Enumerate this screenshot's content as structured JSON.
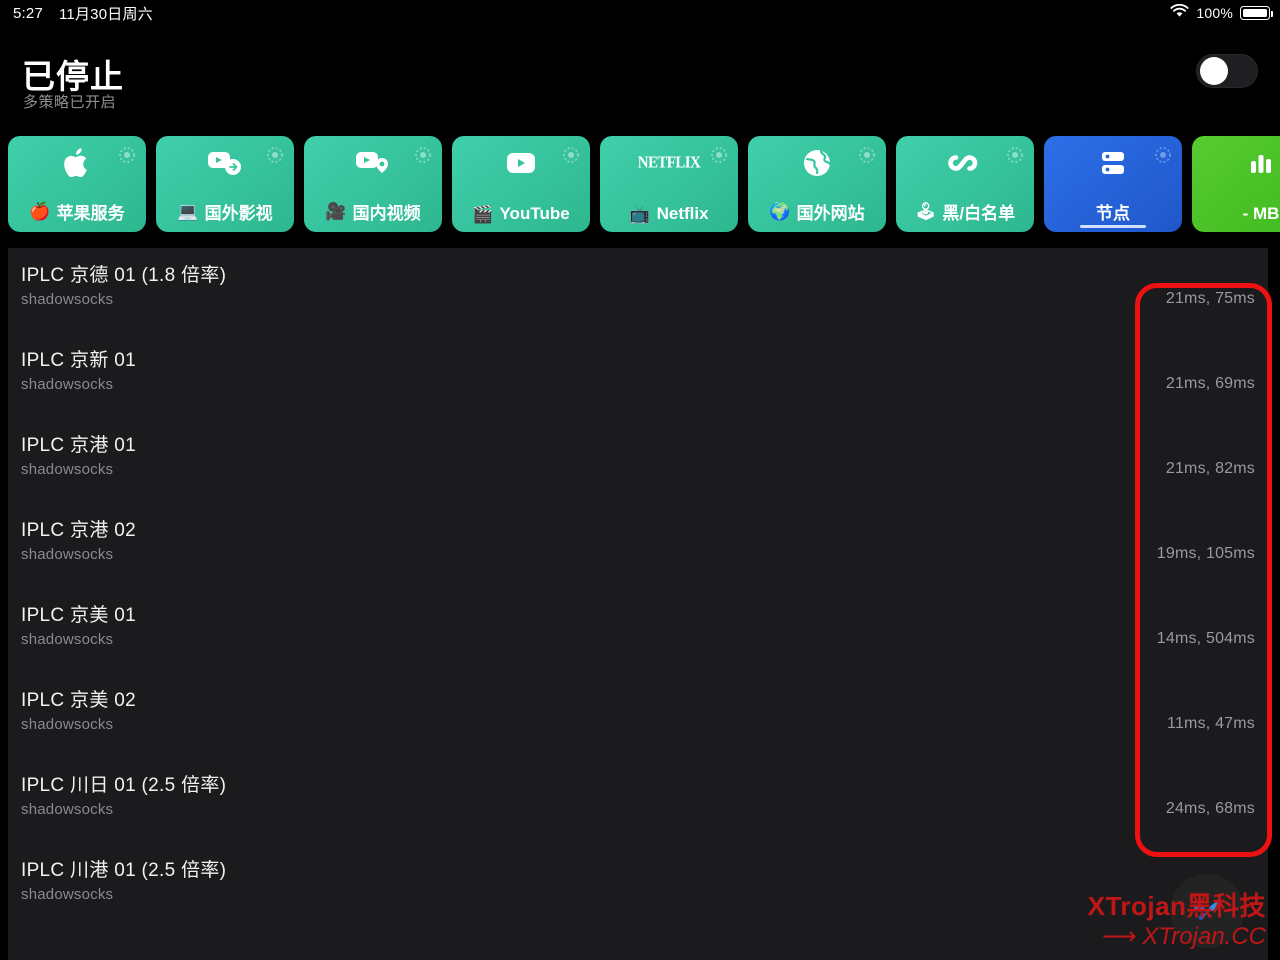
{
  "statusbar": {
    "time": "5:27",
    "date": "11月30日周六",
    "battery_percent": "100%",
    "wifi_icon": "wifi-icon",
    "battery_icon": "battery-full-icon"
  },
  "header": {
    "title": "已停止",
    "subtitle": "多策略已开启",
    "toggle_state": "off"
  },
  "cards": [
    {
      "label": "苹果服务",
      "emoji": "🍎",
      "icon": "apple-logo-icon",
      "gear": "gear-icon",
      "theme": "teal",
      "selected": false
    },
    {
      "label": "国外影视",
      "emoji": "💻",
      "icon": "video-forward-icon",
      "gear": "gear-icon",
      "theme": "teal",
      "selected": false
    },
    {
      "label": "国内视频",
      "emoji": "🎥",
      "icon": "video-pin-icon",
      "gear": "gear-icon",
      "theme": "teal",
      "selected": false
    },
    {
      "label": "YouTube",
      "emoji": "🎬",
      "icon": "youtube-icon",
      "gear": "gear-icon",
      "theme": "teal",
      "selected": false
    },
    {
      "label": "Netflix",
      "emoji": "📺",
      "icon": "netflix-wordmark-icon",
      "icon_text": "NETFLIX",
      "gear": "gear-icon",
      "theme": "teal",
      "selected": false
    },
    {
      "label": "国外网站",
      "emoji": "🌍",
      "icon": "globe-icon",
      "gear": "gear-icon",
      "theme": "teal",
      "selected": false
    },
    {
      "label": "黑/白名单",
      "emoji": "🕹",
      "icon": "infinity-icon",
      "gear": "gear-icon",
      "theme": "teal",
      "selected": false
    },
    {
      "label": "节点",
      "emoji": "",
      "icon": "server-icon",
      "gear": "gear-icon",
      "theme": "blue",
      "selected": true
    },
    {
      "label": "- MB",
      "emoji": "",
      "icon": "bar-chart-icon",
      "gear": "",
      "theme": "green",
      "selected": false
    }
  ],
  "nodes": [
    {
      "name": "IPLC 京德 01 (1.8 倍率)",
      "type": "shadowsocks",
      "latency": "21ms, 75ms"
    },
    {
      "name": "IPLC 京新 01",
      "type": "shadowsocks",
      "latency": "21ms, 69ms"
    },
    {
      "name": "IPLC 京港 01",
      "type": "shadowsocks",
      "latency": "21ms, 82ms"
    },
    {
      "name": "IPLC 京港 02",
      "type": "shadowsocks",
      "latency": "19ms, 105ms"
    },
    {
      "name": "IPLC 京美 01",
      "type": "shadowsocks",
      "latency": "14ms, 504ms"
    },
    {
      "name": "IPLC 京美 02",
      "type": "shadowsocks",
      "latency": "11ms, 47ms"
    },
    {
      "name": "IPLC 川日 01 (2.5 倍率)",
      "type": "shadowsocks",
      "latency": "24ms, 68ms"
    },
    {
      "name": "IPLC 川港 01 (2.5 倍率)",
      "type": "shadowsocks",
      "latency": ""
    }
  ],
  "annotation": {
    "shape": "red-rounded-rect",
    "color": "#ee1111"
  },
  "watermark": {
    "line1": "XTrojan黑科技",
    "arrow": "⟶",
    "line2": "XTrojan.CC",
    "color": "#c01616"
  },
  "colors": {
    "background": "#000000",
    "panel": "#1b1b1d",
    "teal_card": "#33c69f",
    "blue_card": "#2664dd",
    "green_card": "#4cc32c",
    "accent_red": "#ee1111",
    "text_primary": "#f2f2f2",
    "text_secondary": "#8a8a8e"
  }
}
